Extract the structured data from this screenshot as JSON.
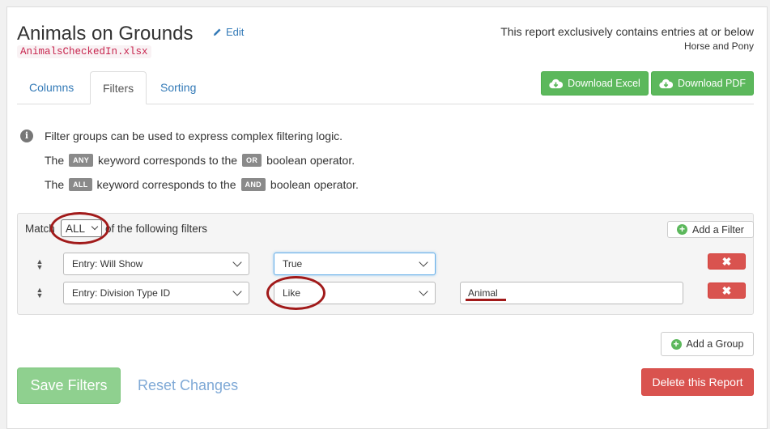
{
  "header": {
    "title": "Animals on Grounds",
    "edit_label": "Edit",
    "filename": "AnimalsCheckedIn.xlsx",
    "note_line1": "This report exclusively contains entries at or below",
    "note_line2": "Horse and Pony"
  },
  "tabs": [
    {
      "label": "Columns",
      "active": false
    },
    {
      "label": "Filters",
      "active": true
    },
    {
      "label": "Sorting",
      "active": false
    }
  ],
  "downloads": {
    "excel_label": "Download Excel",
    "pdf_label": "Download PDF"
  },
  "info": {
    "line1": "Filter groups can be used to express complex filtering logic.",
    "line2_prefix": "The",
    "line2_kw": "ANY",
    "line2_mid": "keyword corresponds to the",
    "line2_op": "OR",
    "line2_suffix": "boolean operator.",
    "line3_prefix": "The",
    "line3_kw": "ALL",
    "line3_mid": "keyword corresponds to the",
    "line3_op": "AND",
    "line3_suffix": "boolean operator."
  },
  "filter_group": {
    "match_prefix": "Match",
    "match_value": "ALL",
    "match_suffix": "of the following filters",
    "add_filter_label": "Add a Filter",
    "rows": [
      {
        "field": "Entry: Will Show",
        "operator": "True",
        "value": ""
      },
      {
        "field": "Entry: Division Type ID",
        "operator": "Like",
        "value": "Animal"
      }
    ],
    "remove_symbol": "✖"
  },
  "add_group_label": "Add a Group",
  "footer": {
    "save_label": "Save Filters",
    "reset_label": "Reset Changes",
    "delete_label": "Delete this Report"
  },
  "colors": {
    "link": "#337ab7",
    "success": "#5cb85c",
    "danger": "#d9534f",
    "annotation": "#a11a1a"
  }
}
